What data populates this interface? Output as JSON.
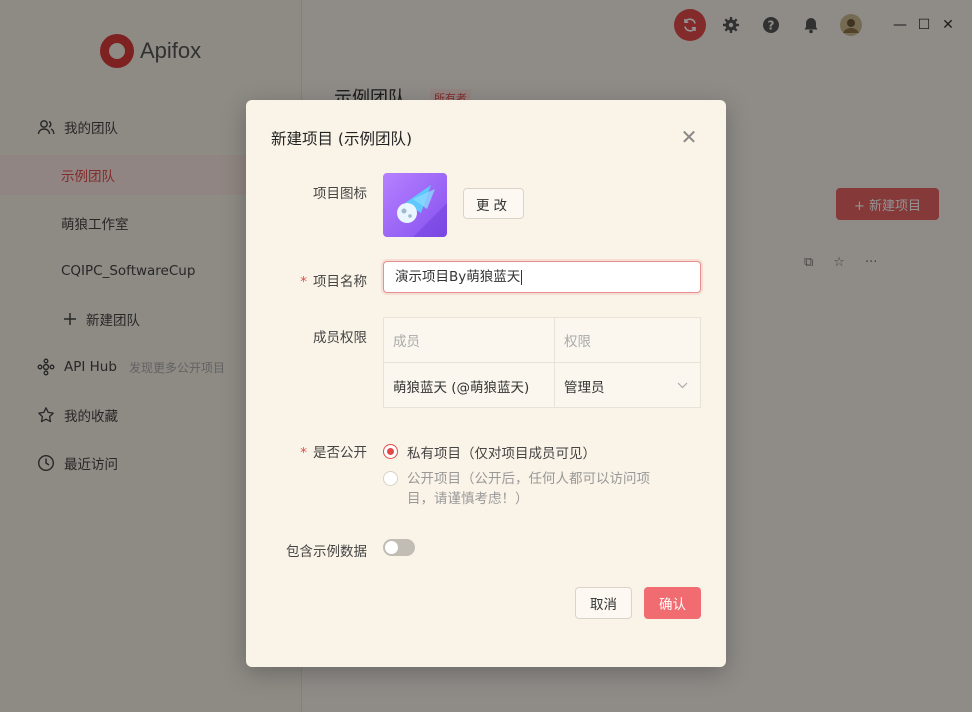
{
  "app": {
    "name": "Apifox"
  },
  "sidebar": {
    "my_teams": "我的团队",
    "teams": [
      {
        "label": "示例团队"
      },
      {
        "label": "萌狼工作室"
      },
      {
        "label": "CQIPC_SoftwareCup"
      }
    ],
    "new_team": "新建团队",
    "api_hub": {
      "label": "API Hub",
      "hint": "发现更多公开项目"
    },
    "favorites": "我的收藏",
    "recent": "最近访问"
  },
  "main": {
    "team_title": "示例团队",
    "owner_badge": "所有者",
    "new_project_button": "+ 新建项目",
    "row_icons": [
      "⧉",
      "☆",
      "···"
    ]
  },
  "window_controls": {
    "minimize": "—",
    "maximize": "☐",
    "close": "✕"
  },
  "modal": {
    "title": "新建项目 (示例团队)",
    "close": "✕",
    "icon_label": "项目图标",
    "change_button": "更改",
    "name_label": "项目名称",
    "name_value": "演示项目By萌狼蓝天",
    "members_label": "成员权限",
    "members_table": {
      "headers": [
        "成员",
        "权限"
      ],
      "rows": [
        {
          "member": "萌狼蓝天 (@萌狼蓝天)",
          "role": "管理员"
        }
      ]
    },
    "public_label": "是否公开",
    "options": [
      {
        "label": "私有项目（仅对项目成员可见）",
        "selected": true
      },
      {
        "label": "公开项目（公开后，任何人都可以访问项目，请谨慎考虑！）",
        "selected": false
      }
    ],
    "sample_data_label": "包含示例数据",
    "sample_data_enabled": false,
    "cancel": "取消",
    "confirm": "确认"
  },
  "colors": {
    "accent": "#e24a4a",
    "primary_button": "#f06c70",
    "modal_bg": "#faf3e7"
  }
}
